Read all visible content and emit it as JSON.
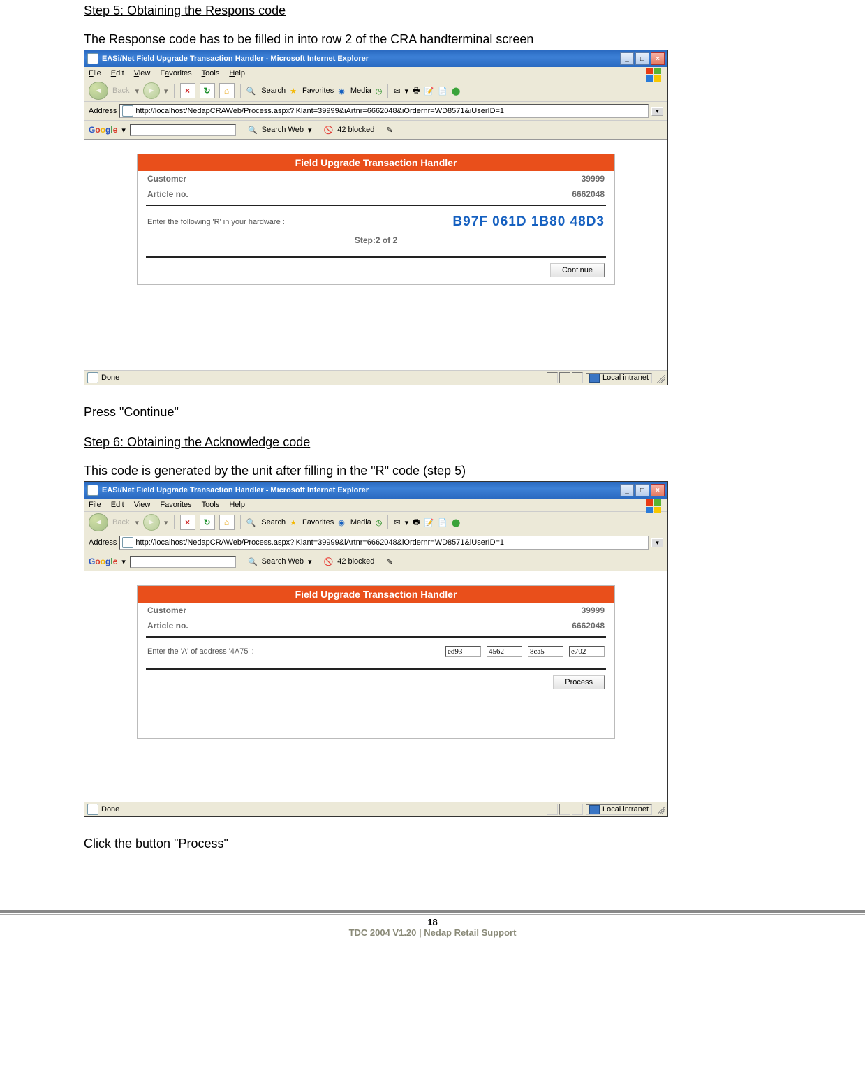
{
  "doc": {
    "step5_heading": "Step 5: Obtaining the Respons code",
    "step5_intro": "The Response code has to be filled in into row 2 of the CRA handterminal screen",
    "press_continue": "Press \"Continue\"",
    "step6_heading": "Step 6: Obtaining the Acknowledge code",
    "step6_intro": "This code is generated by the unit after filling in the \"R\" code  (step 5)",
    "click_process": "Click the button \"Process\""
  },
  "ie": {
    "title": "EASi/Net Field Upgrade Transaction Handler - Microsoft Internet Explorer",
    "menus": {
      "file": "File",
      "edit": "Edit",
      "view": "View",
      "favorites": "Favorites",
      "tools": "Tools",
      "help": "Help"
    },
    "toolbar": {
      "back": "Back",
      "search": "Search",
      "favorites": "Favorites",
      "media": "Media"
    },
    "address_label": "Address",
    "url": "http://localhost/NedapCRAWeb/Process.aspx?iKlant=39999&iArtnr=6662048&iOrdernr=WD8571&iUserID=1",
    "google": {
      "search_web": "Search Web",
      "blocked": "42 blocked"
    },
    "status": {
      "done": "Done",
      "zone": "Local intranet"
    }
  },
  "tx": {
    "header": "Field Upgrade Transaction Handler",
    "customer_label": "Customer",
    "customer_val": "39999",
    "article_label": "Article no.",
    "article_val": "6662048",
    "r_prompt": "Enter the following 'R' in your hardware :",
    "r_code": "B97F 061D 1B80 48D3",
    "step": "Step:2 of 2",
    "continue_btn": "Continue",
    "a_prompt": "Enter the 'A' of address '4A75' :",
    "a_vals": [
      "ed93",
      "4562",
      "8ca5",
      "e702"
    ],
    "process_btn": "Process"
  },
  "footer": {
    "page_num": "18",
    "line": "TDC 2004 V1.20 | Nedap Retail Support"
  }
}
